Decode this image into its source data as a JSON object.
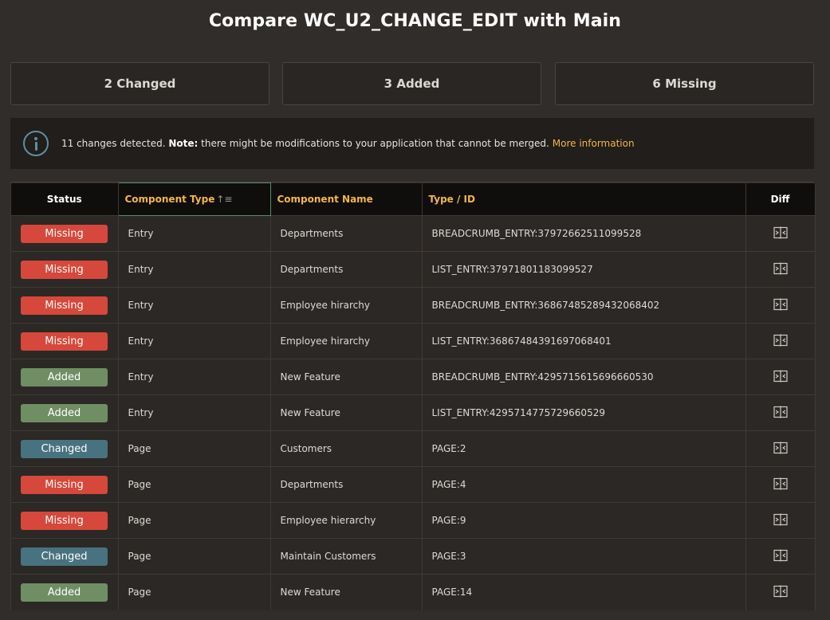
{
  "page_title": "Compare WC_U2_CHANGE_EDIT with Main",
  "summary": {
    "changed_label": "2 Changed",
    "added_label": "3 Added",
    "missing_label": "6 Missing"
  },
  "alert": {
    "count_text": "11 changes detected.",
    "note_label": "Note:",
    "note_text": "there might be modifications to your application that cannot be merged.",
    "link_text": "More information",
    "icon": "info-icon"
  },
  "table": {
    "headers": {
      "status": "Status",
      "component_type": "Component Type",
      "component_name": "Component Name",
      "type_id": "Type / ID",
      "diff": "Diff"
    },
    "rows": [
      {
        "status": "Missing",
        "component_type": "Entry",
        "component_name": "Departments",
        "type_id": "BREADCRUMB_ENTRY:37972662511099528"
      },
      {
        "status": "Missing",
        "component_type": "Entry",
        "component_name": "Departments",
        "type_id": "LIST_ENTRY:37971801183099527"
      },
      {
        "status": "Missing",
        "component_type": "Entry",
        "component_name": "Employee hirarchy",
        "type_id": "BREADCRUMB_ENTRY:36867485289432068402"
      },
      {
        "status": "Missing",
        "component_type": "Entry",
        "component_name": "Employee hirarchy",
        "type_id": "LIST_ENTRY:36867484391697068401"
      },
      {
        "status": "Added",
        "component_type": "Entry",
        "component_name": "New Feature",
        "type_id": "BREADCRUMB_ENTRY:4295715615696660530"
      },
      {
        "status": "Added",
        "component_type": "Entry",
        "component_name": "New Feature",
        "type_id": "LIST_ENTRY:4295714775729660529"
      },
      {
        "status": "Changed",
        "component_type": "Page",
        "component_name": "Customers",
        "type_id": "PAGE:2"
      },
      {
        "status": "Missing",
        "component_type": "Page",
        "component_name": "Departments",
        "type_id": "PAGE:4"
      },
      {
        "status": "Missing",
        "component_type": "Page",
        "component_name": "Employee hierarchy",
        "type_id": "PAGE:9"
      },
      {
        "status": "Changed",
        "component_type": "Page",
        "component_name": "Maintain Customers",
        "type_id": "PAGE:3"
      },
      {
        "status": "Added",
        "component_type": "Page",
        "component_name": "New Feature",
        "type_id": "PAGE:14"
      }
    ]
  },
  "colors": {
    "missing": "#d6483b",
    "added": "#6f8e64",
    "changed": "#48727f",
    "accent": "#f3b54a",
    "background": "#312d2a"
  }
}
